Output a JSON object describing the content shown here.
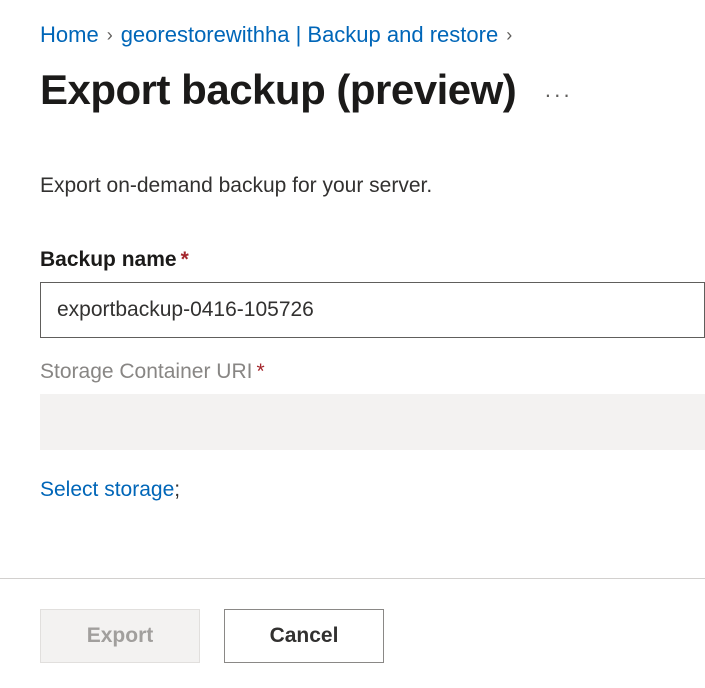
{
  "breadcrumb": {
    "home": "Home",
    "resource": "georestorewithha | Backup and restore"
  },
  "page": {
    "title": "Export backup (preview)",
    "description": "Export on-demand backup for your server."
  },
  "fields": {
    "backup_name": {
      "label": "Backup name",
      "value": "exportbackup-0416-105726"
    },
    "storage_uri": {
      "label": "Storage Container URI",
      "value": ""
    }
  },
  "links": {
    "select_storage": "Select storage"
  },
  "buttons": {
    "export": "Export",
    "cancel": "Cancel"
  }
}
